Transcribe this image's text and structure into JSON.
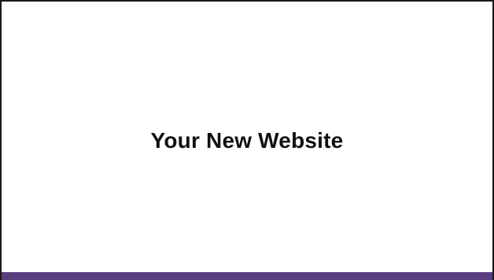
{
  "page": {
    "headline": "Your New Website"
  },
  "colors": {
    "accent_bar": "#5a3f7f",
    "border": "#1a1a1a",
    "text": "#111111",
    "background": "#ffffff"
  }
}
